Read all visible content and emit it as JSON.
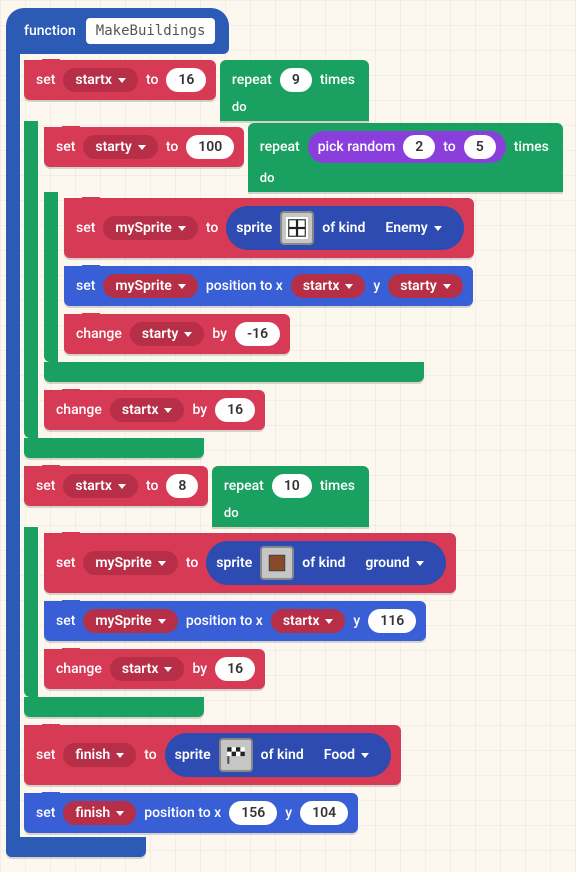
{
  "function": {
    "keyword": "function",
    "name": "MakeBuildings"
  },
  "kw": {
    "set": "set",
    "to": "to",
    "repeat": "repeat",
    "times": "times",
    "do": "do",
    "change": "change",
    "by": "by",
    "position_to_x": "position to x",
    "y": "y",
    "sprite": "sprite",
    "of_kind": "of kind",
    "pick_random": "pick random"
  },
  "vars": {
    "startx": "startx",
    "starty": "starty",
    "mySprite": "mySprite",
    "finish": "finish"
  },
  "kinds": {
    "enemy": "Enemy",
    "ground": "ground",
    "food": "Food"
  },
  "vals": {
    "n16": "16",
    "n9": "9",
    "n100": "100",
    "n2": "2",
    "n5": "5",
    "nNeg16": "-16",
    "n8": "8",
    "n10": "10",
    "n116": "116",
    "n156": "156",
    "n104": "104"
  }
}
